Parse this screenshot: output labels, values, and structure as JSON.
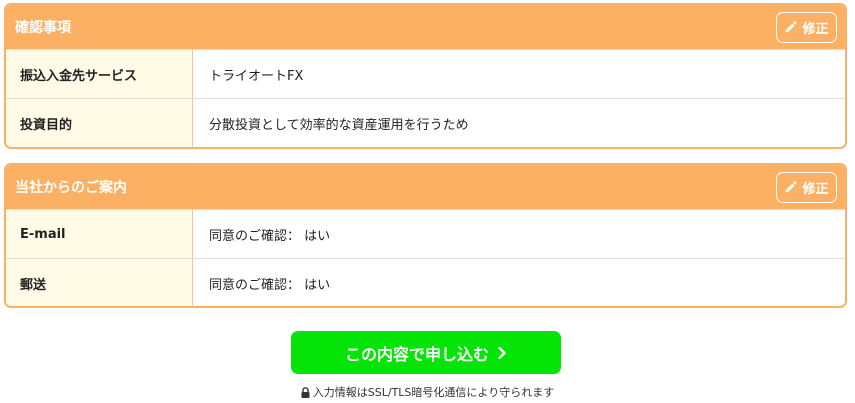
{
  "sections": [
    {
      "title": "確認事項",
      "edit_label": "修正",
      "rows": [
        {
          "label": "振込入金先サービス",
          "value": "トライオートFX"
        },
        {
          "label": "投資目的",
          "value": "分散投資として効率的な資産運用を行うため"
        }
      ]
    },
    {
      "title": "当社からのご案内",
      "edit_label": "修正",
      "rows": [
        {
          "label": "E-mail",
          "value": "同意のご確認： はい"
        },
        {
          "label": "郵送",
          "value": "同意のご確認： はい"
        }
      ]
    }
  ],
  "submit_label": "この内容で申し込む",
  "ssl_note": "入力情報はSSL/TLS暗号化通信により守られます",
  "colors": {
    "header": "#fcb064",
    "label_bg": "#fffbe6",
    "submit": "#06e306"
  }
}
